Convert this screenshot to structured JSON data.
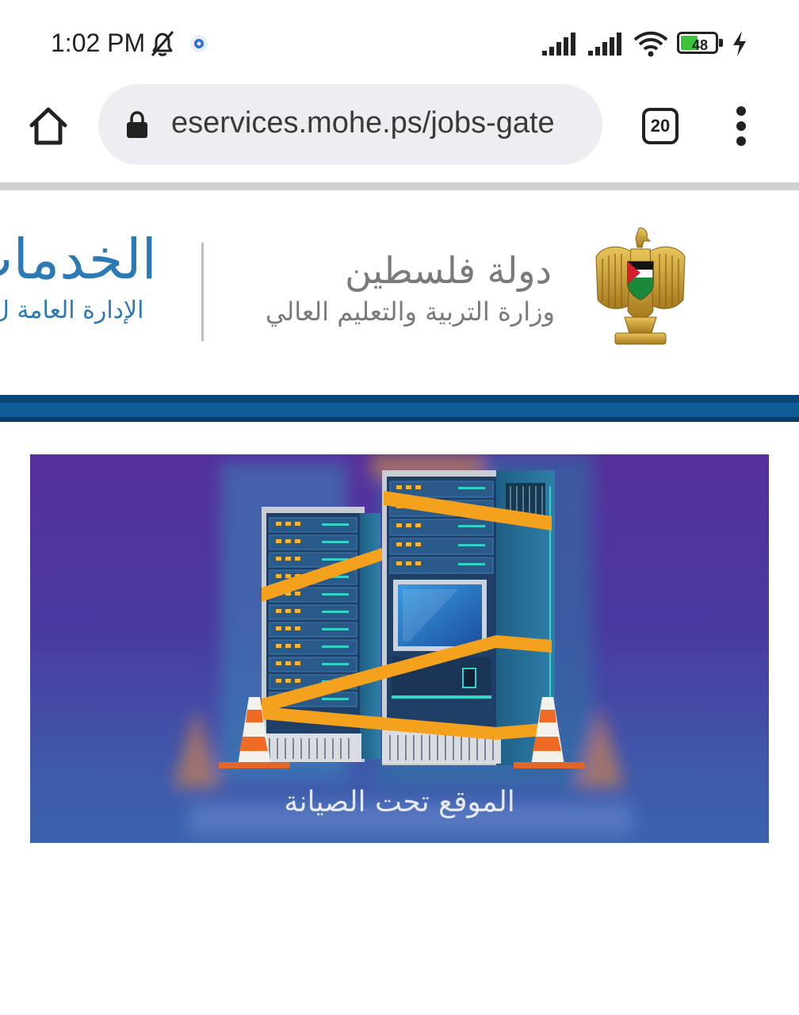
{
  "status_bar": {
    "time": "1:02 PM",
    "battery_level": "48",
    "battery_fraction": 0.48,
    "icons": [
      "bell-off-icon",
      "gear-icon",
      "signal-icon",
      "signal-icon",
      "wifi-icon",
      "battery-icon",
      "charging-bolt-icon"
    ]
  },
  "browser": {
    "url": "eservices.mohe.ps/jobs-gate",
    "tab_count": "20",
    "icons": [
      "home-icon",
      "lock-icon",
      "tabs-icon",
      "more-vert-icon"
    ]
  },
  "site_header": {
    "state_name": "دولة فلسطين",
    "ministry_name": "وزارة التربية والتعليم العالي",
    "services_title": "الخدمات",
    "services_subtitle": "الإدارة العامة ل",
    "emblem": "palestine-eagle-emblem"
  },
  "banner": {
    "text": "الموقع تحت الصيانة"
  },
  "colors": {
    "brand_blue": "#0d5c97",
    "title_blue": "#2b7ab5",
    "banner_purple": "#55309b",
    "tape_orange": "#f4a21d"
  }
}
